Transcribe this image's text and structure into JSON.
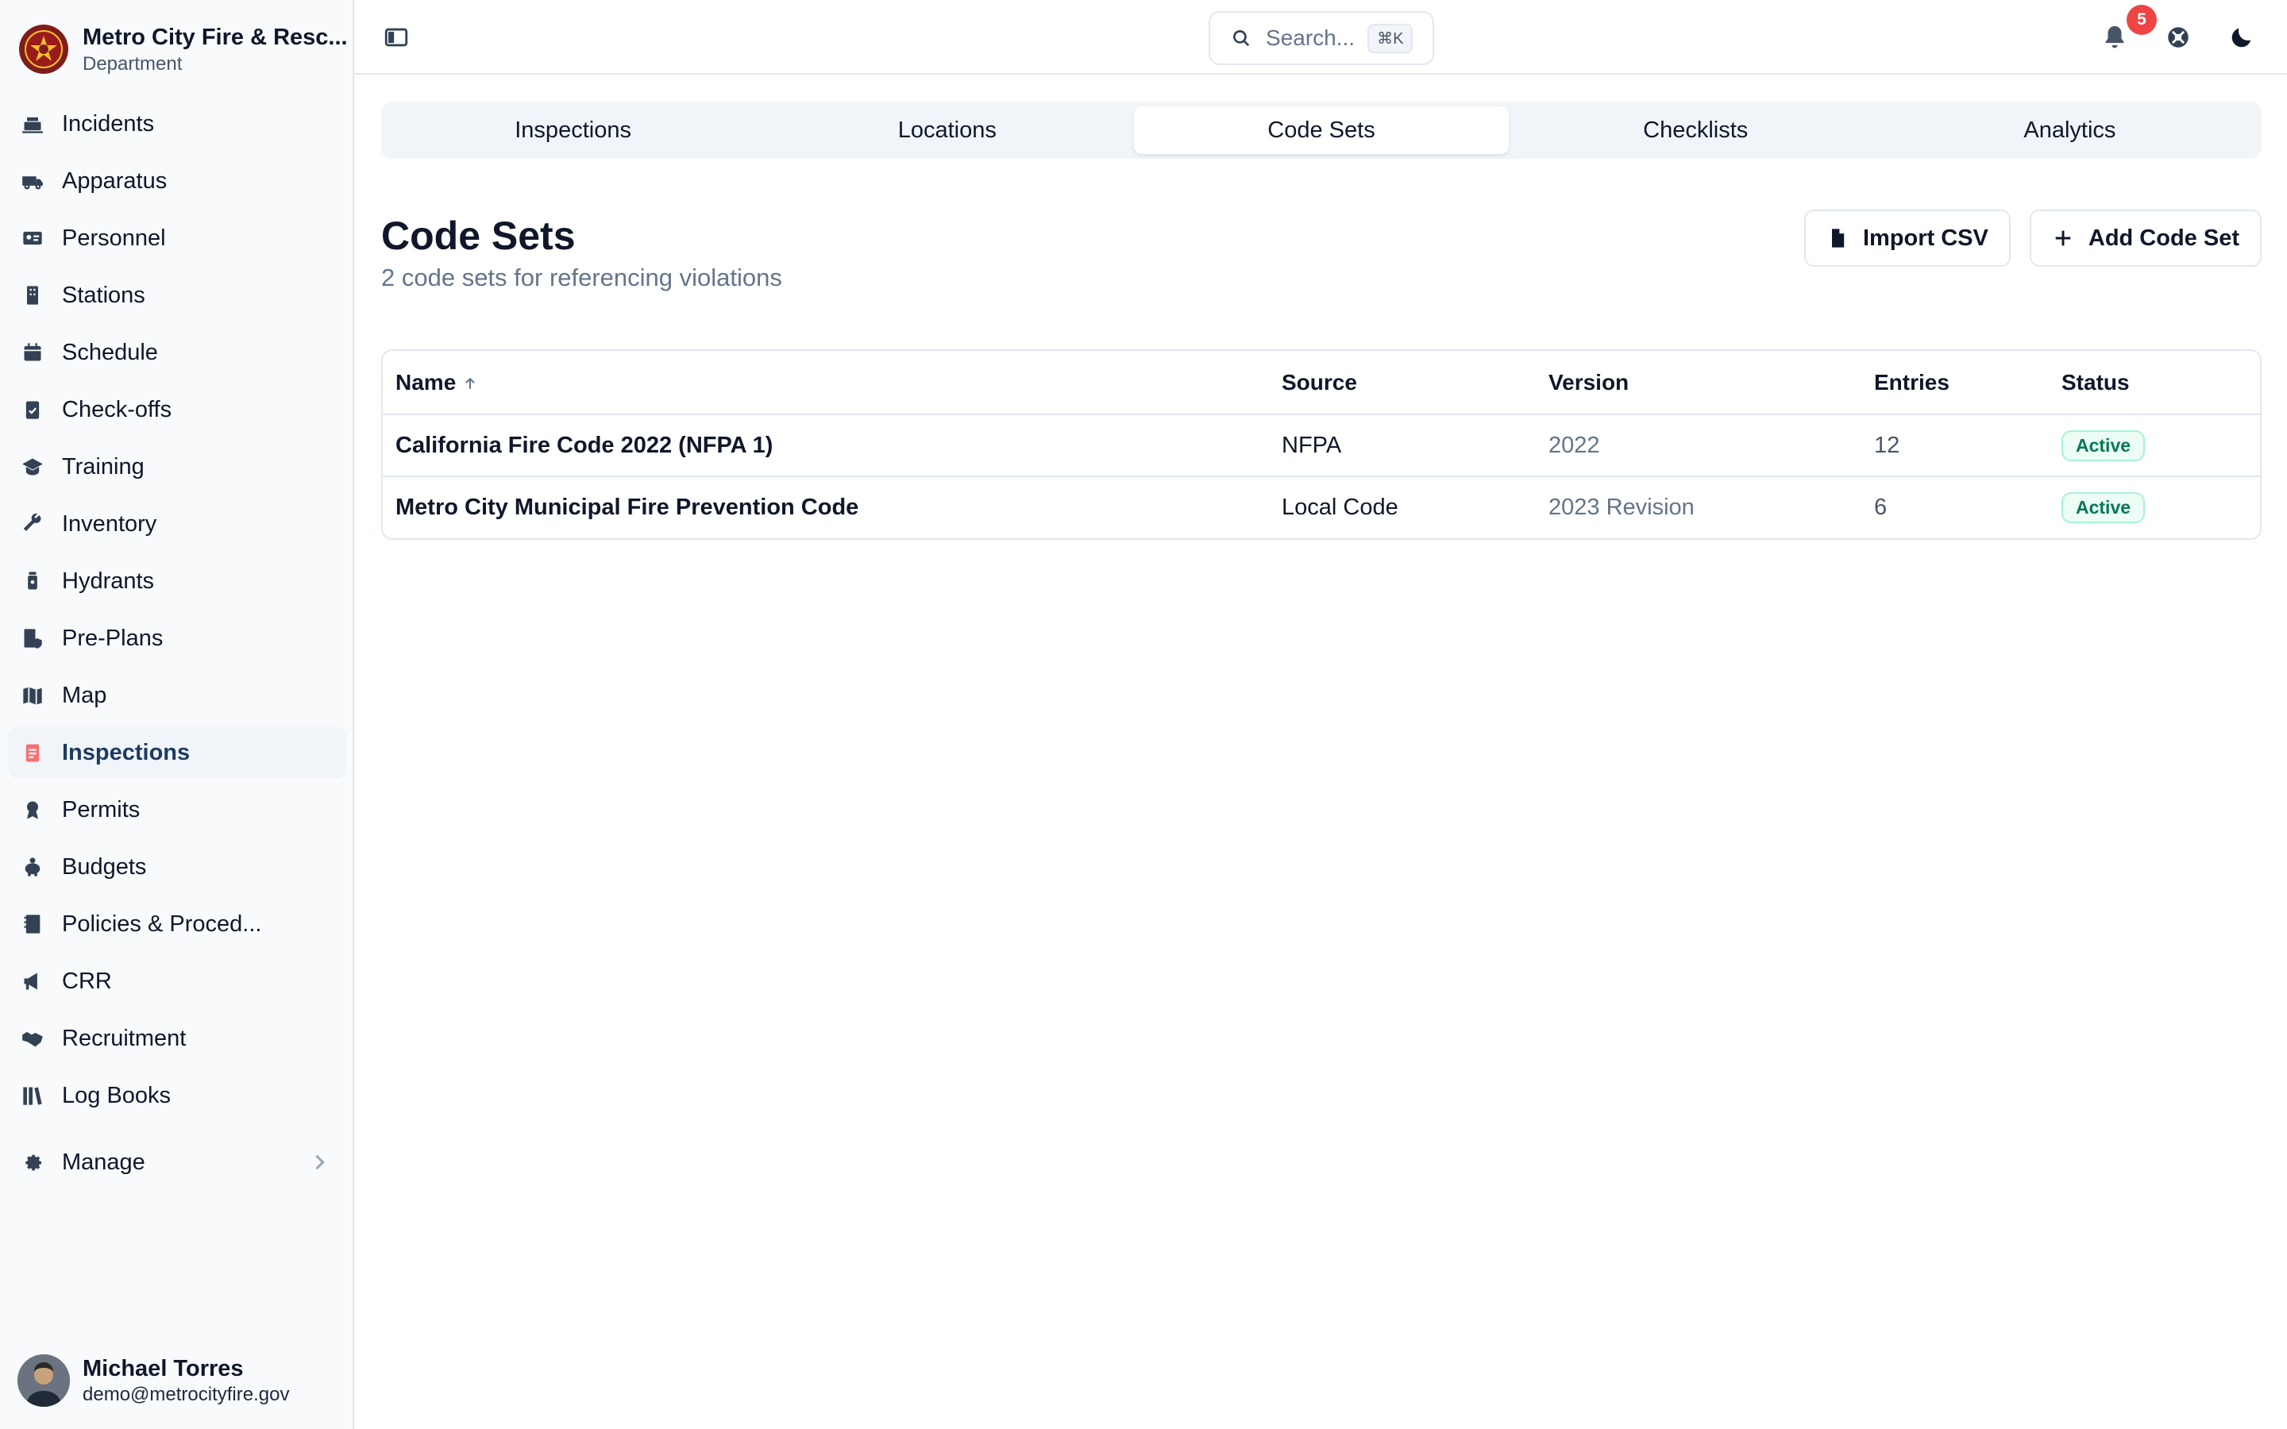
{
  "sidebar": {
    "brand": {
      "name": "Metro City Fire & Resc...",
      "sub": "Department"
    },
    "items": [
      {
        "label": "Incidents",
        "icon": "incidents-icon"
      },
      {
        "label": "Apparatus",
        "icon": "fire-truck-icon"
      },
      {
        "label": "Personnel",
        "icon": "id-card-icon"
      },
      {
        "label": "Stations",
        "icon": "building-icon"
      },
      {
        "label": "Schedule",
        "icon": "calendar-icon"
      },
      {
        "label": "Check-offs",
        "icon": "clipboard-check-icon"
      },
      {
        "label": "Training",
        "icon": "graduation-cap-icon"
      },
      {
        "label": "Inventory",
        "icon": "wrench-icon"
      },
      {
        "label": "Hydrants",
        "icon": "hydrant-icon"
      },
      {
        "label": "Pre-Plans",
        "icon": "building-shield-icon"
      },
      {
        "label": "Map",
        "icon": "map-icon"
      },
      {
        "label": "Inspections",
        "icon": "clipboard-list-icon"
      },
      {
        "label": "Permits",
        "icon": "award-icon"
      },
      {
        "label": "Budgets",
        "icon": "piggy-bank-icon"
      },
      {
        "label": "Policies & Proced...",
        "icon": "book-icon"
      },
      {
        "label": "CRR",
        "icon": "megaphone-icon"
      },
      {
        "label": "Recruitment",
        "icon": "handshake-icon"
      },
      {
        "label": "Log Books",
        "icon": "books-icon"
      }
    ],
    "active_item": "Inspections",
    "manage_label": "Manage",
    "user": {
      "name": "Michael Torres",
      "email": "demo@metrocityfire.gov"
    }
  },
  "topbar": {
    "search_placeholder": "Search...",
    "search_shortcut": "⌘K",
    "notification_count": "5"
  },
  "tabs": [
    {
      "label": "Inspections",
      "active": false
    },
    {
      "label": "Locations",
      "active": false
    },
    {
      "label": "Code Sets",
      "active": true
    },
    {
      "label": "Checklists",
      "active": false
    },
    {
      "label": "Analytics",
      "active": false
    }
  ],
  "page": {
    "title": "Code Sets",
    "subtitle": "2 code sets for referencing violations",
    "import_label": "Import CSV",
    "add_label": "Add Code Set"
  },
  "table": {
    "columns": [
      "Name",
      "Source",
      "Version",
      "Entries",
      "Status"
    ],
    "rows": [
      {
        "name": "California Fire Code 2022 (NFPA 1)",
        "source": "NFPA",
        "version": "2022",
        "entries": "12",
        "status": "Active"
      },
      {
        "name": "Metro City Municipal Fire Prevention Code",
        "source": "Local Code",
        "version": "2023 Revision",
        "entries": "6",
        "status": "Active"
      }
    ]
  },
  "colors": {
    "accent": "#1e3a5f",
    "active_icon": "#f87171",
    "status_green": "#047857",
    "badge_red": "#ef4444"
  }
}
